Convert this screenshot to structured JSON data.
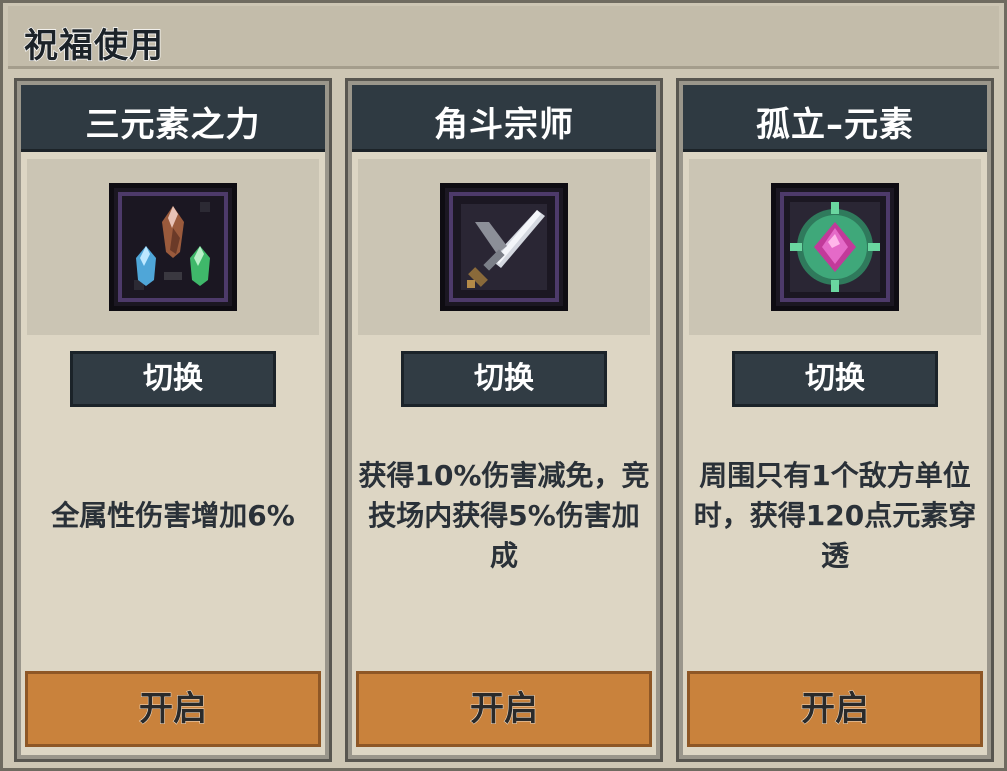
{
  "header": {
    "title": "祝福使用"
  },
  "cards": [
    {
      "title": "三元素之力",
      "icon": "three-elements-crystals-icon",
      "switch_label": "切换",
      "description": "全属性伤害增加6%",
      "open_label": "开启"
    },
    {
      "title": "角斗宗师",
      "icon": "gladiator-sword-icon",
      "switch_label": "切换",
      "description": "获得10%伤害减免，竞技场内获得5%伤害加成",
      "open_label": "开启"
    },
    {
      "title": "孤立–元素",
      "icon": "isolated-element-gem-icon",
      "switch_label": "切换",
      "description": "周围只有1个敌方单位时，获得120点元素穿透",
      "open_label": "开启"
    }
  ],
  "colors": {
    "title_bar": "#2f3a42",
    "open_button": "#c9823c",
    "card_bg": "#ddd6c4"
  }
}
